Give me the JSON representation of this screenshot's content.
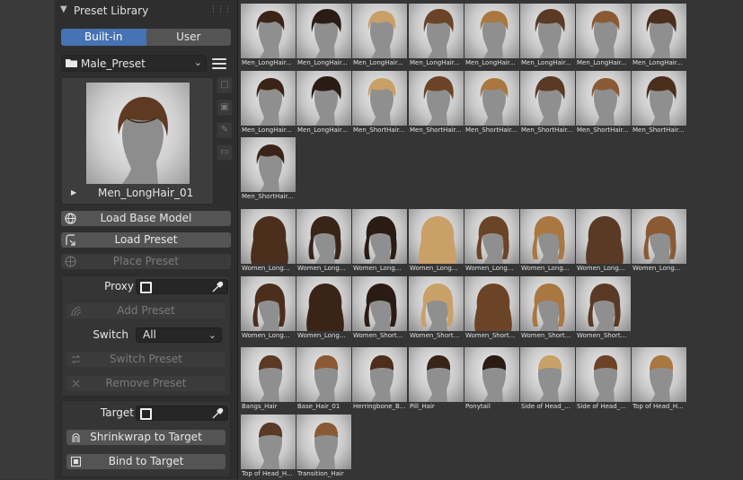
{
  "panel": {
    "title": "Preset Library",
    "tabs": [
      {
        "label": "Built-in",
        "active": true
      },
      {
        "label": "User",
        "active": false
      }
    ],
    "folder": "Male_Preset",
    "preview_name": "Men_LongHair_01",
    "buttons": {
      "load_base_model": "Load Base Model",
      "load_preset": "Load Preset",
      "place_preset": "Place Preset"
    },
    "proxy": {
      "label": "Proxy",
      "add_preset": "Add Preset",
      "switch_label": "Switch",
      "switch_value": "All",
      "switch_preset": "Switch Preset",
      "remove_preset": "Remove Preset"
    },
    "target": {
      "label": "Target",
      "shrinkwrap": "Shrinkwrap to Target",
      "bind": "Bind to Target"
    }
  },
  "colors": {
    "accent": "#4772b3",
    "panel_bg": "#2e2e2e",
    "button": "#545454",
    "area_bg": "#353535"
  },
  "icons": [
    "chevron-down-icon",
    "grip-icon",
    "folder-icon",
    "hamburger-menu-icon",
    "play-icon",
    "add-thumbnail-icon",
    "image-icon",
    "edit-icon",
    "trash-icon",
    "globe-icon",
    "import-icon",
    "hair-curl-icon",
    "clear-icon",
    "object-icon",
    "eyedropper-icon",
    "shrinkwrap-icon",
    "bind-icon"
  ],
  "library": {
    "male": [
      "Men_LongHair...",
      "Men_LongHair...",
      "Men_LongHair...",
      "Men_LongHair...",
      "Men_LongHair...",
      "Men_LongHair...",
      "Men_LongHair...",
      "Men_LongHair...",
      "Men_LongHair...",
      "Men_LongHair...",
      "Men_ShortHair...",
      "Men_ShortHair...",
      "Men_ShortHair...",
      "Men_ShortHair...",
      "Men_ShortHair...",
      "Men_ShortHair...",
      "Men_ShortHair..."
    ],
    "female": [
      "Women_Long...",
      "Women_Long...",
      "Women_Long...",
      "Women_Long...",
      "Women_Long...",
      "Women_Long...",
      "Women_Long...",
      "Women_Long...",
      "Women_Long...",
      "Women_Long...",
      "Women_Short...",
      "Women_Short...",
      "Women_Short...",
      "Women_Short...",
      "Women_Short..."
    ],
    "parts": [
      "Bangs_Hair",
      "Base_Hair_01",
      "Herringbone_B...",
      "Pill_Hair",
      "Ponytail",
      "Side of Head_...",
      "Side of Head_...",
      "Top of Head_H...",
      "Top of Head_H...",
      "Transition_Hair"
    ]
  }
}
